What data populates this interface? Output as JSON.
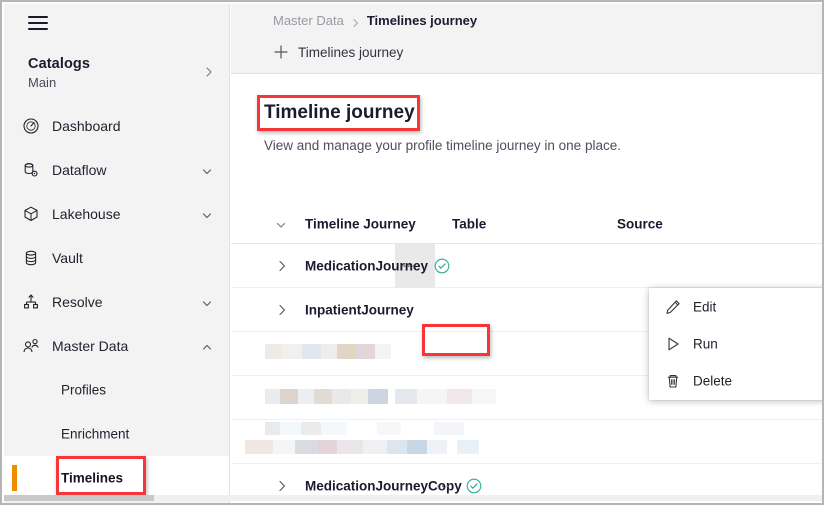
{
  "colors": {
    "accent_orange": "#f08c00",
    "highlight_red": "#f5363b",
    "status_green": "#2fae8f",
    "sidebar_bg": "#f3f3f3",
    "topbar_bg": "#f3f3f3",
    "text_primary": "#1b1b2f",
    "text_muted": "#9a9aa2"
  },
  "sidebar": {
    "menu_icon": "hamburger-icon",
    "catalog": {
      "title": "Catalogs",
      "subtitle": "Main",
      "chevron": "chevron-right-icon"
    },
    "items": [
      {
        "label": "Dashboard",
        "icon": "gauge-icon",
        "chevron": ""
      },
      {
        "label": "Dataflow",
        "icon": "database-gear-icon",
        "chevron": "chevron-down-icon"
      },
      {
        "label": "Lakehouse",
        "icon": "cube-icon",
        "chevron": "chevron-down-icon"
      },
      {
        "label": "Vault",
        "icon": "database-icon",
        "chevron": ""
      },
      {
        "label": "Resolve",
        "icon": "hierarchy-icon",
        "chevron": "chevron-down-icon"
      },
      {
        "label": "Master Data",
        "icon": "people-icon",
        "chevron": "chevron-up-icon"
      }
    ],
    "sub_items": [
      {
        "label": "Profiles",
        "active": false,
        "highlighted": false
      },
      {
        "label": "Enrichment",
        "active": false,
        "highlighted": false
      },
      {
        "label": "Timelines",
        "active": true,
        "highlighted": true
      }
    ]
  },
  "topbar": {
    "breadcrumb": {
      "parent": "Master Data",
      "separator_icon": "chevron-right-icon",
      "current": "Timelines journey"
    },
    "tab": {
      "add_icon": "plus-icon",
      "label": "Timelines journey"
    }
  },
  "page": {
    "title": "Timeline journey",
    "title_highlighted": true,
    "subtitle": "View and manage your profile timeline journey in one place."
  },
  "table": {
    "expander_icon": "chevron-down-icon",
    "row_expander_icon": "chevron-right-icon",
    "columns": [
      "Timeline Journey",
      "Table",
      "Source"
    ],
    "rows": [
      {
        "name": "MedicationJourney",
        "menu_icon": "ellipsis-icon",
        "status_icon": "check-circle-icon",
        "redacted": false,
        "hover": true
      },
      {
        "name": "InpatientJourney",
        "menu_icon": "ellipsis-icon",
        "status_icon": "",
        "redacted": false,
        "hover": false
      },
      {
        "name": "",
        "menu_icon": "",
        "status_icon": "",
        "redacted": true,
        "hover": false
      },
      {
        "name": "",
        "menu_icon": "",
        "status_icon": "",
        "redacted": true,
        "hover": false
      },
      {
        "name": "",
        "menu_icon": "",
        "status_icon": "",
        "redacted": true,
        "hover": false
      },
      {
        "name": "MedicationJourneyCopy",
        "menu_icon": "ellipsis-icon",
        "status_icon": "check-circle-icon",
        "redacted": false,
        "hover": false
      }
    ]
  },
  "context_menu": {
    "items": [
      {
        "label": "Edit",
        "icon": "pencil-icon",
        "highlighted": false
      },
      {
        "label": "Run",
        "icon": "play-icon",
        "highlighted": true
      },
      {
        "label": "Delete",
        "icon": "trash-icon",
        "highlighted": false
      }
    ]
  }
}
